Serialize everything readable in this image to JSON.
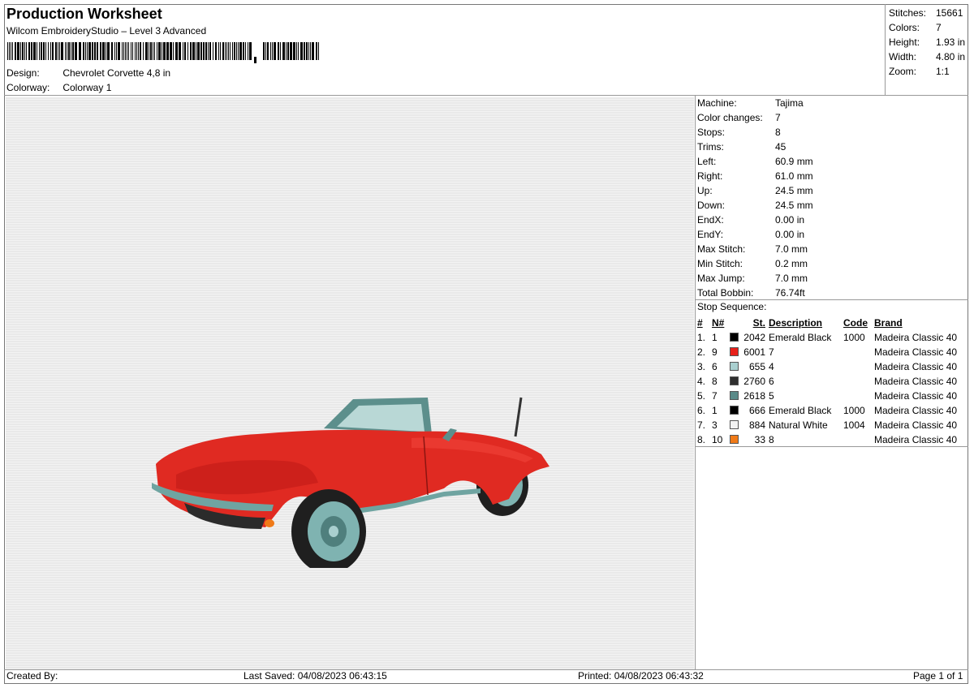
{
  "header": {
    "title": "Production Worksheet",
    "software": "Wilcom EmbroideryStudio – Level 3 Advanced",
    "design_label": "Design:",
    "design_value": "Chevrolet Corvette 4,8 in",
    "colorway_label": "Colorway:",
    "colorway_value": "Colorway 1"
  },
  "summary": [
    {
      "label": "Stitches:",
      "value": "15661"
    },
    {
      "label": "Colors:",
      "value": "7"
    },
    {
      "label": "Height:",
      "value": "1.93 in"
    },
    {
      "label": "Width:",
      "value": "4.80 in"
    },
    {
      "label": "Zoom:",
      "value": "1:1"
    }
  ],
  "machine_info": [
    {
      "label": "Machine:",
      "value": "Tajima"
    },
    {
      "label": "Color changes:",
      "value": "7"
    },
    {
      "label": "Stops:",
      "value": "8"
    },
    {
      "label": "Trims:",
      "value": "45"
    },
    {
      "label": "Left:",
      "value": "60.9 mm"
    },
    {
      "label": "Right:",
      "value": "61.0 mm"
    },
    {
      "label": "Up:",
      "value": "24.5 mm"
    },
    {
      "label": "Down:",
      "value": "24.5 mm"
    },
    {
      "label": "EndX:",
      "value": "0.00 in"
    },
    {
      "label": "EndY:",
      "value": "0.00 in"
    },
    {
      "label": "Max Stitch:",
      "value": "7.0 mm"
    },
    {
      "label": "Min Stitch:",
      "value": "0.2 mm"
    },
    {
      "label": "Max Jump:",
      "value": "7.0 mm"
    },
    {
      "label": "Total Bobbin:",
      "value": "76.74ft"
    }
  ],
  "stop_sequence": {
    "title": "Stop Sequence:",
    "columns": [
      "#",
      "N#",
      "St.",
      "Description",
      "Code",
      "Brand"
    ],
    "rows": [
      {
        "num": "1.",
        "n": "1",
        "color": "#000000",
        "st": "2042",
        "desc": "Emerald Black",
        "code": "1000",
        "brand": "Madeira Classic 40"
      },
      {
        "num": "2.",
        "n": "9",
        "color": "#e8201a",
        "st": "6001",
        "desc": "7",
        "code": "",
        "brand": "Madeira Classic 40"
      },
      {
        "num": "3.",
        "n": "6",
        "color": "#a9cfcf",
        "st": "655",
        "desc": "4",
        "code": "",
        "brand": "Madeira Classic 40"
      },
      {
        "num": "4.",
        "n": "8",
        "color": "#2f2f2f",
        "st": "2760",
        "desc": "6",
        "code": "",
        "brand": "Madeira Classic 40"
      },
      {
        "num": "5.",
        "n": "7",
        "color": "#5a8a88",
        "st": "2618",
        "desc": "5",
        "code": "",
        "brand": "Madeira Classic 40"
      },
      {
        "num": "6.",
        "n": "1",
        "color": "#000000",
        "st": "666",
        "desc": "Emerald Black",
        "code": "1000",
        "brand": "Madeira Classic 40"
      },
      {
        "num": "7.",
        "n": "3",
        "color": "#f2f2f2",
        "st": "884",
        "desc": "Natural White",
        "code": "1004",
        "brand": "Madeira Classic 40"
      },
      {
        "num": "8.",
        "n": "10",
        "color": "#f07a18",
        "st": "33",
        "desc": "8",
        "code": "",
        "brand": "Madeira Classic 40"
      }
    ]
  },
  "footer": {
    "created_by": "Created By:",
    "last_saved": "Last Saved: 04/08/2023 06:43:15",
    "printed": "Printed: 04/08/2023 06:43:32",
    "page": "Page 1 of 1"
  }
}
